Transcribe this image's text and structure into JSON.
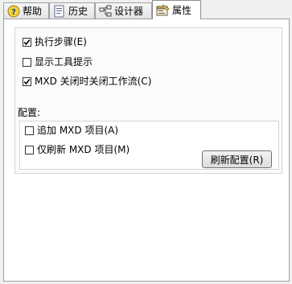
{
  "tabs": [
    {
      "label": "帮助",
      "icon": "help-icon",
      "active": false
    },
    {
      "label": "历史",
      "icon": "history-icon",
      "active": false
    },
    {
      "label": "设计器",
      "icon": "designer-icon",
      "active": false
    },
    {
      "label": "属性",
      "icon": "properties-icon",
      "active": true
    }
  ],
  "options": {
    "execute_steps": {
      "label": "执行步骤(E)",
      "checked": true
    },
    "show_tooltips": {
      "label": "显示工具提示",
      "checked": false
    },
    "close_workflow": {
      "label": "MXD 关闭时关闭工作流(C)",
      "checked": true
    }
  },
  "config": {
    "title": "配置:",
    "append_mxd": {
      "label": "追加 MXD 项目(A)",
      "checked": false
    },
    "refresh_mxd_only": {
      "label": "仅刷新 MXD 项目(M)",
      "checked": false
    },
    "refresh_button": "刷新配置(R)"
  }
}
